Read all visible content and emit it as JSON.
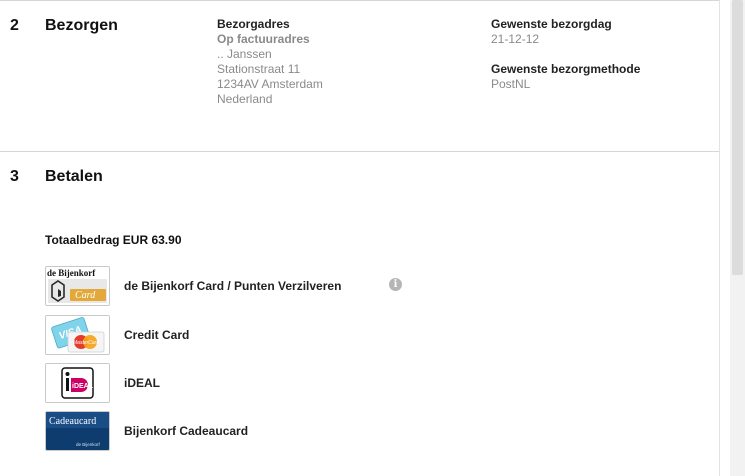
{
  "steps": [
    {
      "number": "2",
      "title": "Bezorgen"
    },
    {
      "number": "3",
      "title": "Betalen"
    }
  ],
  "delivery_address": {
    "heading": "Bezorgadres",
    "subheading": "Op factuuradres",
    "lines": [
      ".. Janssen",
      "Stationstraat 11",
      "1234AV Amsterdam",
      "Nederland"
    ]
  },
  "delivery_day": {
    "heading": "Gewenste bezorgdag",
    "value": "21-12-12"
  },
  "delivery_method": {
    "heading": "Gewenste bezorgmethode",
    "value": "PostNL"
  },
  "payment": {
    "total_label": "Totaalbedrag EUR 63.90",
    "options": [
      {
        "label": "de Bijenkorf Card / Punten Verzilveren",
        "logo_text": [
          "de Bijenkorf",
          "Card"
        ],
        "icon": "bijenkorf-card-icon"
      },
      {
        "label": "Credit Card",
        "logo_text": [
          "VISA",
          "MasterCard"
        ],
        "icon": "credit-card-icon"
      },
      {
        "label": "iDEAL",
        "logo_text": [
          "iDEAL"
        ],
        "icon": "ideal-icon"
      },
      {
        "label": "Bijenkorf Cadeaucard",
        "logo_text": [
          "Cadeaucard",
          "de Bijenkorf"
        ],
        "icon": "cadeaucard-icon"
      }
    ],
    "info_glyph": "i"
  },
  "colors": {
    "heading": "#111111",
    "muted": "#8a8a8a",
    "rule": "#d6d6d6",
    "ideal_pink": "#cc0066",
    "bijenkorf_gold": "#e3a83a",
    "cadeau_blue": "#0f3c6e"
  }
}
